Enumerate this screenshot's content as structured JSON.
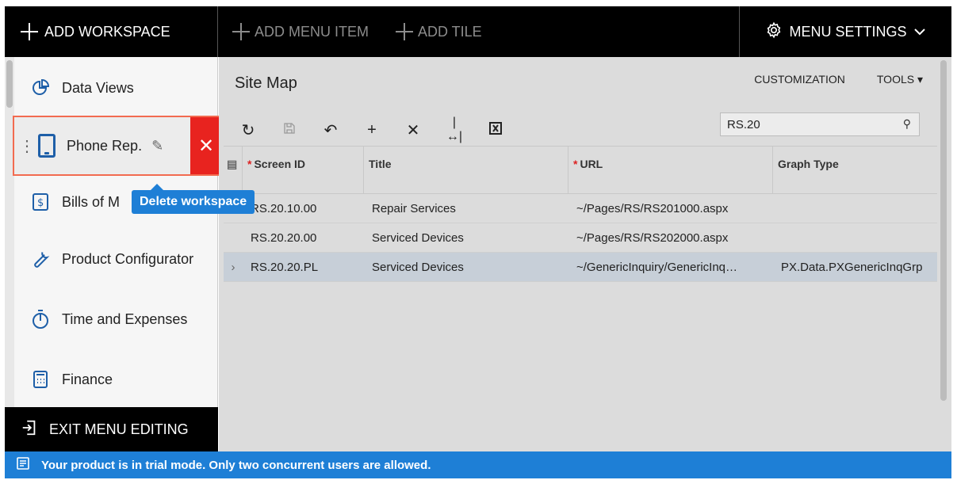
{
  "topbar": {
    "add_workspace": "ADD WORKSPACE",
    "add_menu_item": "ADD MENU ITEM",
    "add_tile": "ADD TILE",
    "menu_settings": "MENU SETTINGS"
  },
  "sidebar": {
    "items": [
      {
        "label": "Data Views",
        "icon": "pie-chart-icon"
      },
      {
        "label": "Phone Rep.",
        "icon": "phone-icon",
        "selected": true
      },
      {
        "label": "Bills of M",
        "icon": "invoice-icon"
      },
      {
        "label": "Product Configurator",
        "icon": "wrench-icon"
      },
      {
        "label": "Time and Expenses",
        "icon": "stopwatch-icon"
      },
      {
        "label": "Finance",
        "icon": "calculator-icon"
      }
    ],
    "tooltip": "Delete workspace",
    "exit_label": "EXIT MENU EDITING"
  },
  "main": {
    "title": "Site Map",
    "links": {
      "customization": "CUSTOMIZATION",
      "tools": "TOOLS"
    },
    "search": {
      "value": "RS.20"
    },
    "columns": {
      "screen_id": "Screen ID",
      "title": "Title",
      "url": "URL",
      "graph_type": "Graph Type"
    },
    "rows": [
      {
        "screen_id": "RS.20.10.00",
        "title": "Repair Services",
        "url": "~/Pages/RS/RS201000.aspx",
        "graph_type": ""
      },
      {
        "screen_id": "RS.20.20.00",
        "title": "Serviced Devices",
        "url": "~/Pages/RS/RS202000.aspx",
        "graph_type": ""
      },
      {
        "screen_id": "RS.20.20.PL",
        "title": "Serviced Devices",
        "url": "~/GenericInquiry/GenericInq…",
        "graph_type": "PX.Data.PXGenericInqGrp"
      }
    ]
  },
  "status": {
    "message": "Your product is in trial mode. Only two concurrent users are allowed."
  },
  "colors": {
    "accent": "#1e7fd6",
    "delete": "#e8231f",
    "selected_border": "#f26b50"
  }
}
